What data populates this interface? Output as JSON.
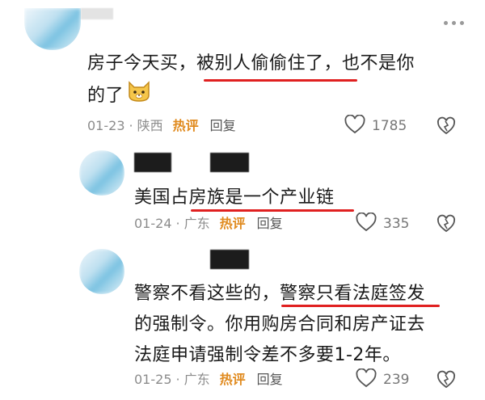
{
  "comments": [
    {
      "text_line1": "房子今天买，被别人偷偷住了，也不是你",
      "text_line2": "的了",
      "emoji": "cat-face-emoji",
      "date": "01-23",
      "region": "陕西",
      "hot_label": "热评",
      "reply_label": "回复",
      "likes": "1785"
    },
    {
      "text_line1": "美国占房族是一个产业链",
      "date": "01-24",
      "region": "广东",
      "hot_label": "热评",
      "reply_label": "回复",
      "likes": "335"
    },
    {
      "text_line1": "警察不看这些的，警察只看法庭签发",
      "text_line2": "的强制令。你用购房合同和房产证去",
      "text_line3": "法庭申请强制令差不多要1-2年。",
      "date": "01-25",
      "region": "广东",
      "hot_label": "热评",
      "reply_label": "回复",
      "likes": "239"
    }
  ],
  "colors": {
    "hot": "#e08a1e",
    "underline": "#e02020",
    "meta": "#8c8c8c"
  }
}
